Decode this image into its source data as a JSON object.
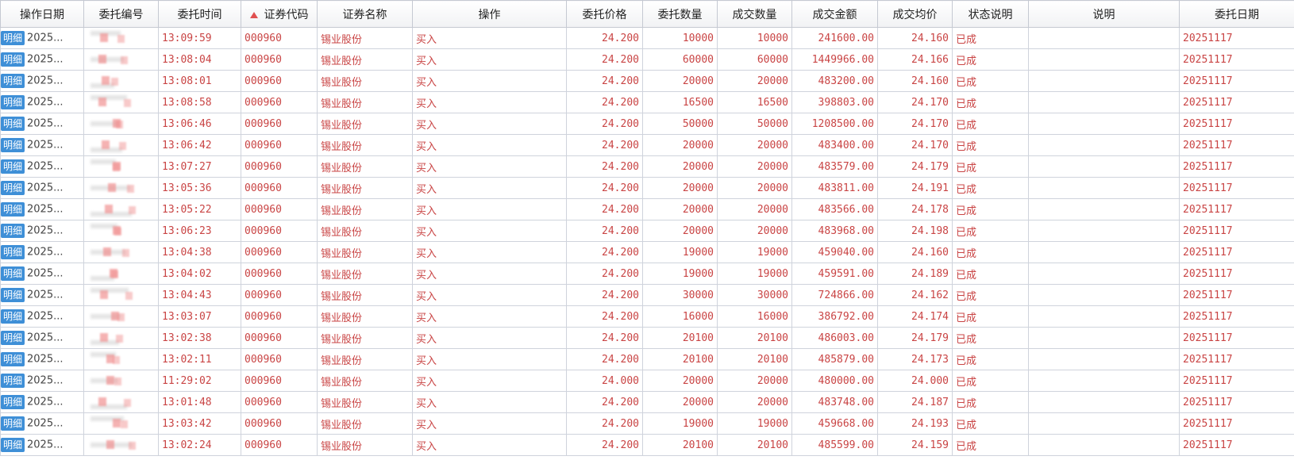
{
  "columns": [
    "操作日期",
    "委托编号",
    "委托时间",
    "证券代码",
    "证券名称",
    "操作",
    "委托价格",
    "委托数量",
    "成交数量",
    "成交金额",
    "成交均价",
    "状态说明",
    "说明",
    "委托日期"
  ],
  "badge_label": "明细",
  "rows": [
    {
      "op_date": "2025...",
      "time": "13:09:59",
      "code": "000960",
      "name": "锡业股份",
      "action": "买入",
      "price": "24.200",
      "qty": "10000",
      "filled": "10000",
      "amount": "241600.00",
      "avg": "24.160",
      "status": "已成",
      "note": "",
      "date": "20251117"
    },
    {
      "op_date": "2025...",
      "time": "13:08:04",
      "code": "000960",
      "name": "锡业股份",
      "action": "买入",
      "price": "24.200",
      "qty": "60000",
      "filled": "60000",
      "amount": "1449966.00",
      "avg": "24.166",
      "status": "已成",
      "note": "",
      "date": "20251117"
    },
    {
      "op_date": "2025...",
      "time": "13:08:01",
      "code": "000960",
      "name": "锡业股份",
      "action": "买入",
      "price": "24.200",
      "qty": "20000",
      "filled": "20000",
      "amount": "483200.00",
      "avg": "24.160",
      "status": "已成",
      "note": "",
      "date": "20251117"
    },
    {
      "op_date": "2025...",
      "time": "13:08:58",
      "code": "000960",
      "name": "锡业股份",
      "action": "买入",
      "price": "24.200",
      "qty": "16500",
      "filled": "16500",
      "amount": "398803.00",
      "avg": "24.170",
      "status": "已成",
      "note": "",
      "date": "20251117"
    },
    {
      "op_date": "2025...",
      "time": "13:06:46",
      "code": "000960",
      "name": "锡业股份",
      "action": "买入",
      "price": "24.200",
      "qty": "50000",
      "filled": "50000",
      "amount": "1208500.00",
      "avg": "24.170",
      "status": "已成",
      "note": "",
      "date": "20251117"
    },
    {
      "op_date": "2025...",
      "time": "13:06:42",
      "code": "000960",
      "name": "锡业股份",
      "action": "买入",
      "price": "24.200",
      "qty": "20000",
      "filled": "20000",
      "amount": "483400.00",
      "avg": "24.170",
      "status": "已成",
      "note": "",
      "date": "20251117"
    },
    {
      "op_date": "2025...",
      "time": "13:07:27",
      "code": "000960",
      "name": "锡业股份",
      "action": "买入",
      "price": "24.200",
      "qty": "20000",
      "filled": "20000",
      "amount": "483579.00",
      "avg": "24.179",
      "status": "已成",
      "note": "",
      "date": "20251117"
    },
    {
      "op_date": "2025...",
      "time": "13:05:36",
      "code": "000960",
      "name": "锡业股份",
      "action": "买入",
      "price": "24.200",
      "qty": "20000",
      "filled": "20000",
      "amount": "483811.00",
      "avg": "24.191",
      "status": "已成",
      "note": "",
      "date": "20251117"
    },
    {
      "op_date": "2025...",
      "time": "13:05:22",
      "code": "000960",
      "name": "锡业股份",
      "action": "买入",
      "price": "24.200",
      "qty": "20000",
      "filled": "20000",
      "amount": "483566.00",
      "avg": "24.178",
      "status": "已成",
      "note": "",
      "date": "20251117"
    },
    {
      "op_date": "2025...",
      "time": "13:06:23",
      "code": "000960",
      "name": "锡业股份",
      "action": "买入",
      "price": "24.200",
      "qty": "20000",
      "filled": "20000",
      "amount": "483968.00",
      "avg": "24.198",
      "status": "已成",
      "note": "",
      "date": "20251117"
    },
    {
      "op_date": "2025...",
      "time": "13:04:38",
      "code": "000960",
      "name": "锡业股份",
      "action": "买入",
      "price": "24.200",
      "qty": "19000",
      "filled": "19000",
      "amount": "459040.00",
      "avg": "24.160",
      "status": "已成",
      "note": "",
      "date": "20251117"
    },
    {
      "op_date": "2025...",
      "time": "13:04:02",
      "code": "000960",
      "name": "锡业股份",
      "action": "买入",
      "price": "24.200",
      "qty": "19000",
      "filled": "19000",
      "amount": "459591.00",
      "avg": "24.189",
      "status": "已成",
      "note": "",
      "date": "20251117"
    },
    {
      "op_date": "2025...",
      "time": "13:04:43",
      "code": "000960",
      "name": "锡业股份",
      "action": "买入",
      "price": "24.200",
      "qty": "30000",
      "filled": "30000",
      "amount": "724866.00",
      "avg": "24.162",
      "status": "已成",
      "note": "",
      "date": "20251117"
    },
    {
      "op_date": "2025...",
      "time": "13:03:07",
      "code": "000960",
      "name": "锡业股份",
      "action": "买入",
      "price": "24.200",
      "qty": "16000",
      "filled": "16000",
      "amount": "386792.00",
      "avg": "24.174",
      "status": "已成",
      "note": "",
      "date": "20251117"
    },
    {
      "op_date": "2025...",
      "time": "13:02:38",
      "code": "000960",
      "name": "锡业股份",
      "action": "买入",
      "price": "24.200",
      "qty": "20100",
      "filled": "20100",
      "amount": "486003.00",
      "avg": "24.179",
      "status": "已成",
      "note": "",
      "date": "20251117"
    },
    {
      "op_date": "2025...",
      "time": "13:02:11",
      "code": "000960",
      "name": "锡业股份",
      "action": "买入",
      "price": "24.200",
      "qty": "20100",
      "filled": "20100",
      "amount": "485879.00",
      "avg": "24.173",
      "status": "已成",
      "note": "",
      "date": "20251117"
    },
    {
      "op_date": "2025...",
      "time": "11:29:02",
      "code": "000960",
      "name": "锡业股份",
      "action": "买入",
      "price": "24.000",
      "qty": "20000",
      "filled": "20000",
      "amount": "480000.00",
      "avg": "24.000",
      "status": "已成",
      "note": "",
      "date": "20251117"
    },
    {
      "op_date": "2025...",
      "time": "13:01:48",
      "code": "000960",
      "name": "锡业股份",
      "action": "买入",
      "price": "24.200",
      "qty": "20000",
      "filled": "20000",
      "amount": "483748.00",
      "avg": "24.187",
      "status": "已成",
      "note": "",
      "date": "20251117"
    },
    {
      "op_date": "2025...",
      "time": "13:03:42",
      "code": "000960",
      "name": "锡业股份",
      "action": "买入",
      "price": "24.200",
      "qty": "19000",
      "filled": "19000",
      "amount": "459668.00",
      "avg": "24.193",
      "status": "已成",
      "note": "",
      "date": "20251117"
    },
    {
      "op_date": "2025...",
      "time": "13:02:24",
      "code": "000960",
      "name": "锡业股份",
      "action": "买入",
      "price": "24.200",
      "qty": "20100",
      "filled": "20100",
      "amount": "485599.00",
      "avg": "24.159",
      "status": "已成",
      "note": "",
      "date": "20251117"
    }
  ]
}
